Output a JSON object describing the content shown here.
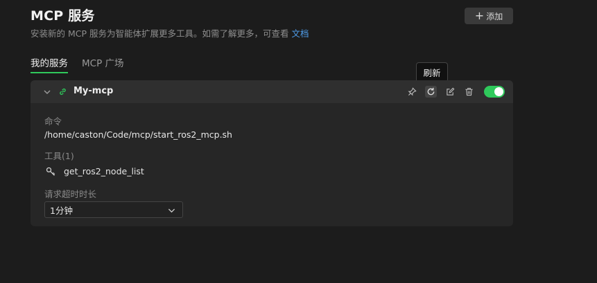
{
  "header": {
    "title": "MCP 服务",
    "subtitle": "安装新的 MCP 服务为智能体扩展更多工具。如需了解更多，可查看",
    "docs_link": "文档",
    "add_label": "添加"
  },
  "tabs": [
    {
      "label": "我的服务",
      "active": true
    },
    {
      "label": "MCP 广场",
      "active": false
    }
  ],
  "tooltip": "刷新",
  "server": {
    "name": "My-mcp",
    "enabled": true,
    "command_label": "命令",
    "command": "/home/caston/Code/mcp/start_ros2_mcp.sh",
    "tools_label": "工具(1)",
    "tools": [
      "get_ros2_node_list"
    ],
    "timeout_label": "请求超时时长",
    "timeout_value": "1分钟"
  },
  "colors": {
    "accent": "#2fc95b",
    "link": "#4f9dea",
    "background": "#1c1c1c",
    "card": "#262626"
  },
  "icons": {
    "add": "plus-icon",
    "collapse": "chevron-down-icon",
    "type": "link-icon",
    "actions": [
      "pin-icon",
      "refresh-icon",
      "edit-icon",
      "delete-icon"
    ],
    "tool": "key-icon",
    "select": "chevron-down-icon"
  }
}
